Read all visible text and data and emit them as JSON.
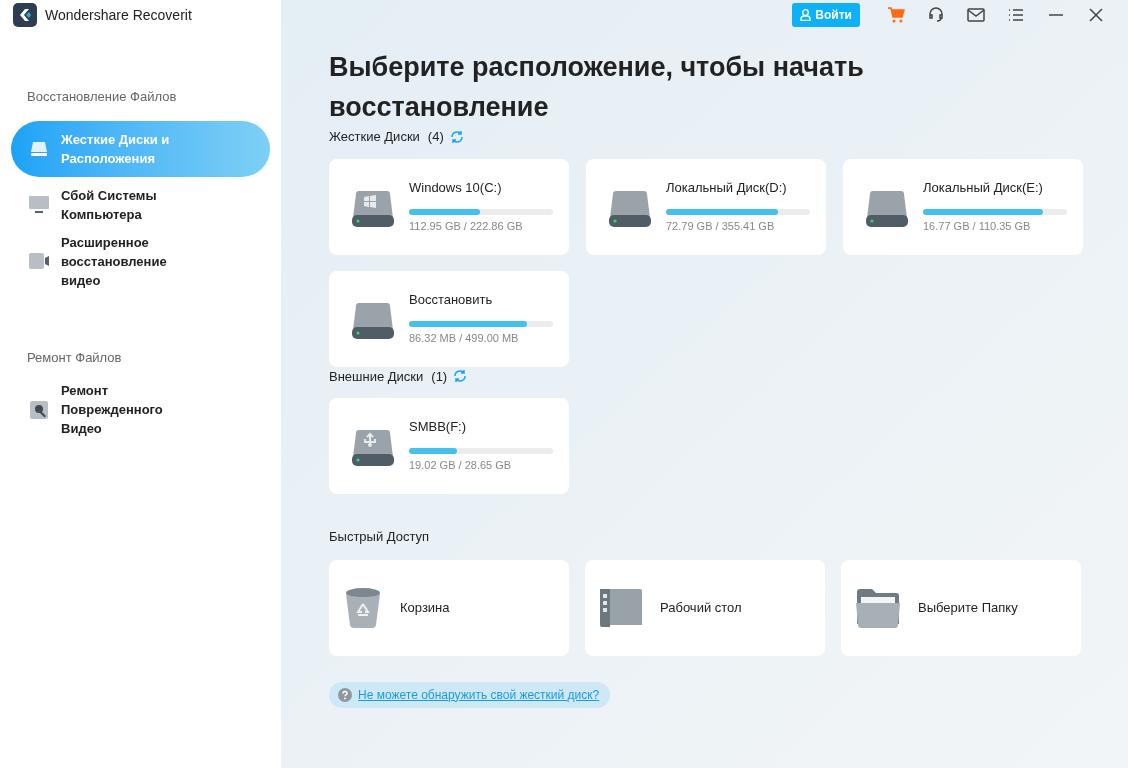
{
  "app": {
    "title": "Wondershare Recoverit"
  },
  "sidebar": {
    "sections": [
      {
        "heading": "Восстановление Файлов",
        "items": [
          {
            "kind": "drive",
            "label": "Жесткие Диски и Расположения",
            "selected": true
          },
          {
            "kind": "monitor",
            "label": "Сбой Системы Компьютера",
            "selected": false
          },
          {
            "kind": "video",
            "label": "Расширенное восстановление видео",
            "selected": false
          }
        ]
      },
      {
        "heading": "Ремонт Файлов",
        "items": [
          {
            "kind": "repair",
            "label": "Ремонт Поврежденного Видео",
            "selected": false
          }
        ]
      }
    ]
  },
  "toolbar": {
    "login_button": "Войти"
  },
  "main": {
    "heading": "Выберите расположение, чтобы начать восстановление",
    "groups": [
      {
        "title": "Жесткие Диски",
        "count": "(4)",
        "drives": [
          {
            "kind": "windows",
            "name": "Windows 10(C:)",
            "level": 0.49,
            "usage": "112.95 GB / 222.86 GB"
          },
          {
            "kind": "plain",
            "name": "Локальный Диск(D:)",
            "level": 0.78,
            "usage": "72.79 GB / 355.41 GB"
          },
          {
            "kind": "plain",
            "name": "Локальный Диск(E:)",
            "level": 0.83,
            "usage": "16.77 GB / 110.35 GB"
          },
          {
            "kind": "plain",
            "name": "Восстановить",
            "level": 0.82,
            "usage": "86.32 MB / 499.00 MB"
          }
        ]
      },
      {
        "title": "Внешние Диски",
        "count": "(1)",
        "drives": [
          {
            "kind": "usb",
            "name": "SMBB(F:)",
            "level": 0.33,
            "usage": "19.02 GB / 28.65 GB"
          }
        ]
      }
    ],
    "quick_access": {
      "title": "Быстрый Доступ",
      "items": [
        {
          "kind": "trash",
          "label": "Корзина"
        },
        {
          "kind": "desktop",
          "label": "Рабочий стол"
        },
        {
          "kind": "folder",
          "label": "Выберите Папку"
        }
      ]
    },
    "help_link": "Не можете обнаружить свой жесткий диск?"
  }
}
